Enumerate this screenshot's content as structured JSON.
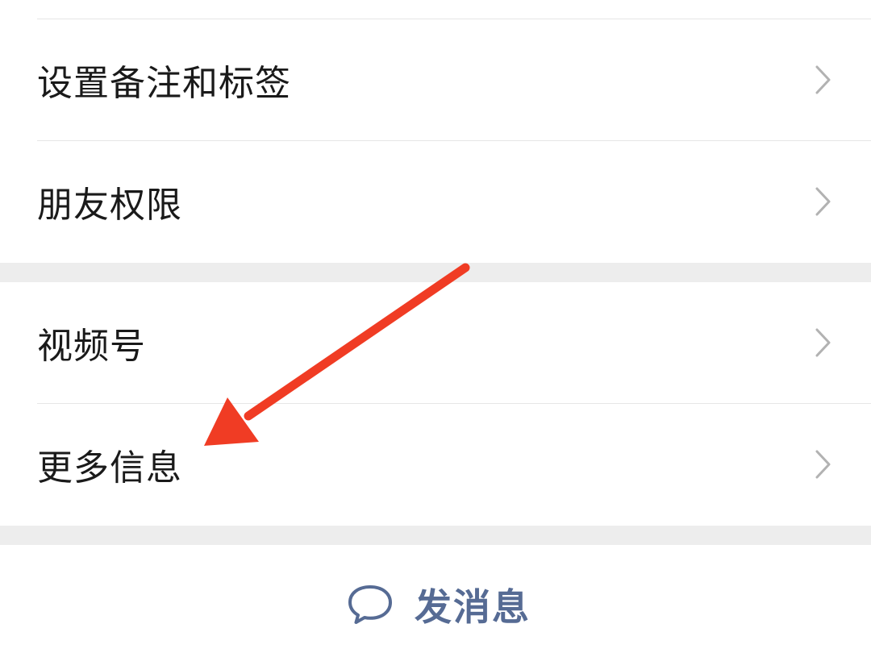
{
  "menu": {
    "items": [
      {
        "label": "设置备注和标签"
      },
      {
        "label": "朋友权限"
      },
      {
        "label": "视频号"
      },
      {
        "label": "更多信息"
      }
    ]
  },
  "actions": {
    "send_message_label": "发消息"
  },
  "icons": {
    "row_chevron": "chevron-right-icon",
    "send_message": "chat-bubble-icon"
  },
  "colors": {
    "background": "#ffffff",
    "section_gap": "#ededed",
    "divider": "#e6e6e6",
    "label_text": "#1a1a1a",
    "chevron": "#b2b2b2",
    "send_accent": "#566b94",
    "annotation_arrow": "#f03c24"
  }
}
